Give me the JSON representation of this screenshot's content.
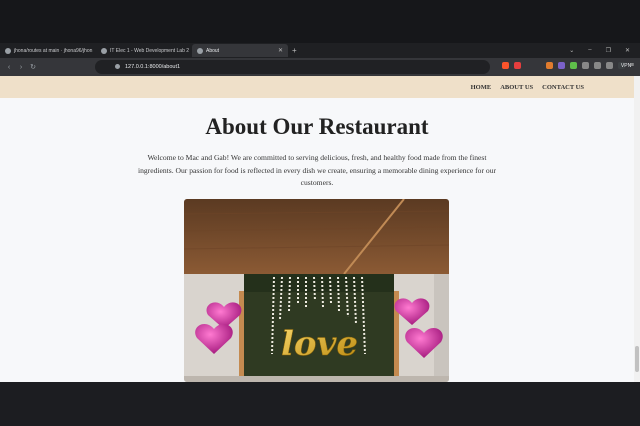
{
  "browser": {
    "tabs": [
      {
        "label": "jhona/routes at main · jhona96/jhon"
      },
      {
        "label": "IT Elec 1 - Web Development Lab 2"
      },
      {
        "label": "About"
      }
    ],
    "url": "127.0.0.1:8000/about1",
    "vpn_label": "VPN"
  },
  "site": {
    "nav": [
      "HOME",
      "ABOUT US",
      "CONTACT US"
    ],
    "title": "About Our Restaurant",
    "intro": "Welcome to Mac and Gab! We are committed to serving delicious, fresh, and healthy food made from the finest ingredients. Our passion for food is reflected in every dish we create, ensuring a memorable dining experience for our customers.",
    "photo_word": "love"
  }
}
